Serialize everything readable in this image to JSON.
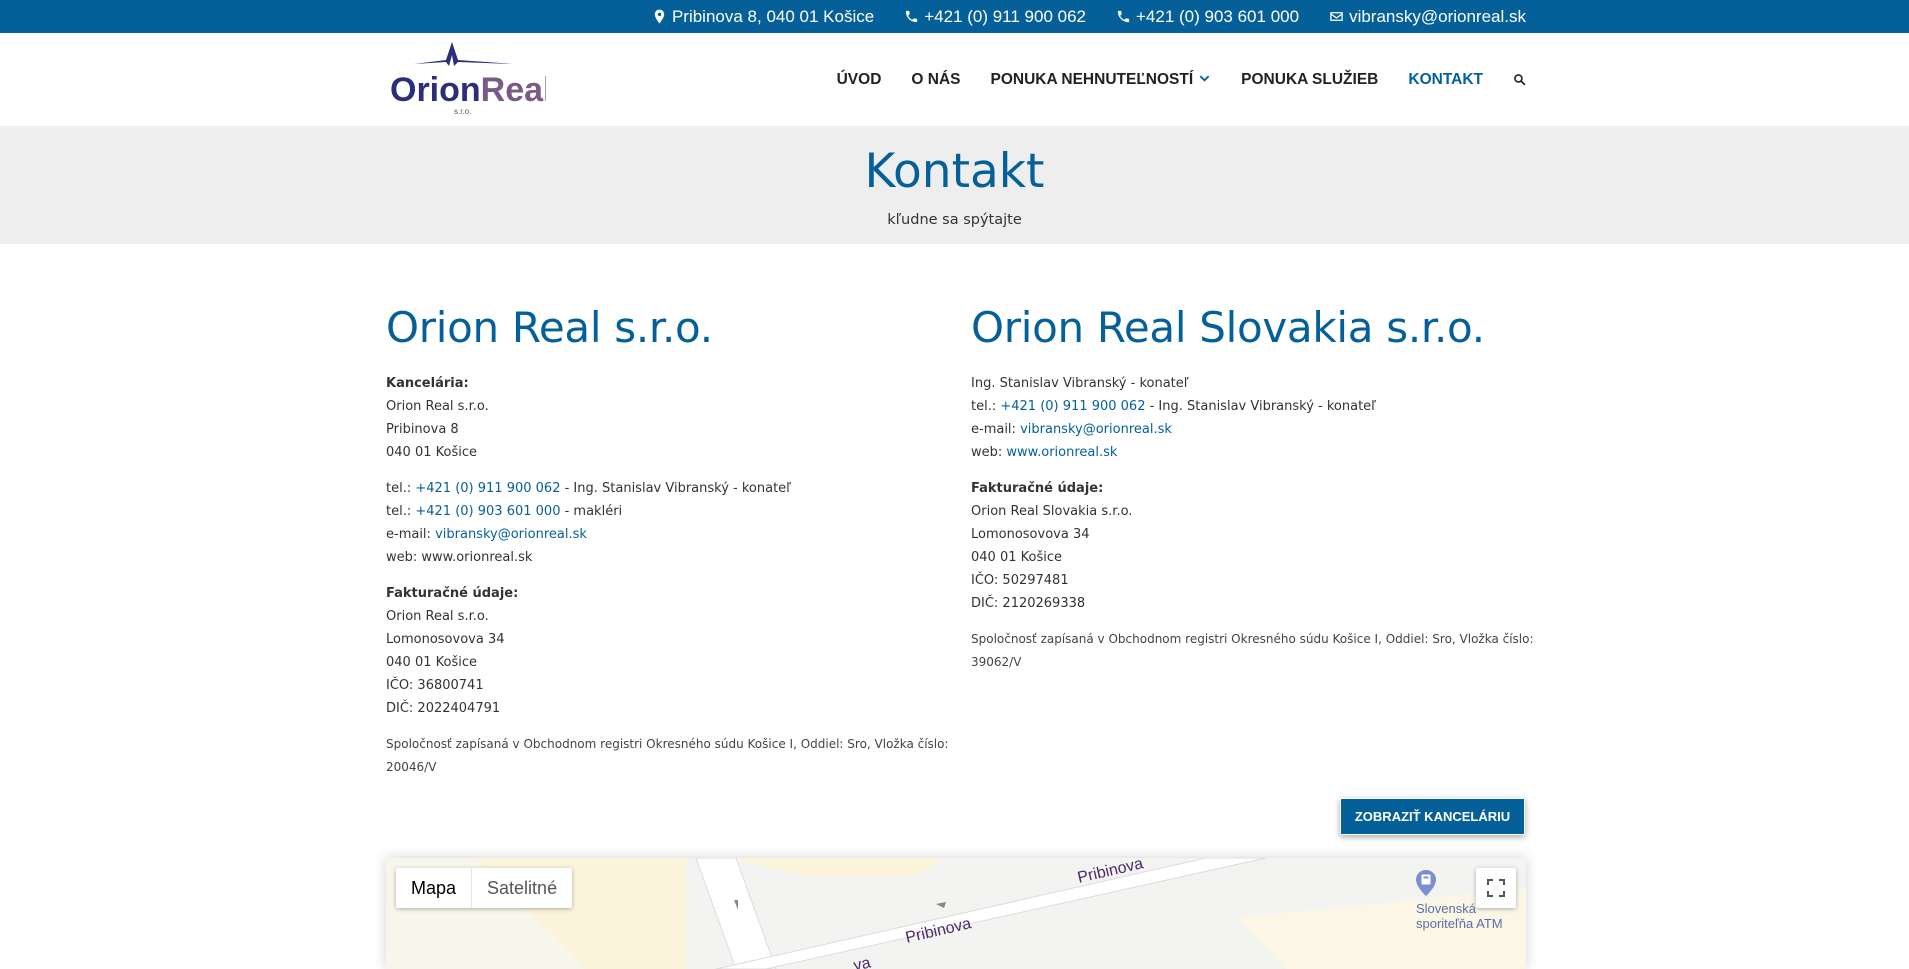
{
  "topbar": {
    "address": "Pribinova 8, 040 01 Košice",
    "phone1": "+421 (0) 911 900 062",
    "phone2": "+421 (0) 903 601 000",
    "email": "vibransky@orionreal.sk"
  },
  "logo": {
    "text_left": "Orion",
    "text_right": "Real",
    "sub": "s.r.o."
  },
  "nav": [
    {
      "label": "ÚVOD"
    },
    {
      "label": "O NÁS"
    },
    {
      "label": "PONUKA NEHNUTEĽNOSTÍ"
    },
    {
      "label": "PONUKA SLUŽIEB"
    },
    {
      "label": "KONTAKT"
    }
  ],
  "colors": {
    "brand": "#05609a",
    "band": "#eeeeee"
  },
  "page": {
    "title": "Kontakt",
    "subtitle": "kľudne sa spýtajte"
  },
  "left": {
    "company": "Orion Real s.r.o.",
    "office_heading": "Kancelária:",
    "office_lines": [
      "Orion Real s.r.o.",
      "Pribinova 8",
      "040 01 Košice"
    ],
    "tel_prefix": "tel.:",
    "tel1_number": "+421 (0) 911 900 062",
    "tel1_suffix": " - Ing. Stanislav Vibranský - konateľ",
    "tel2_number": "+421 (0) 903 601 000",
    "tel2_suffix": " - makléri",
    "email_prefix": "e-mail:",
    "email": "vibransky@orionreal.sk",
    "web_line": "web: www.orionreal.sk",
    "billing_heading": "Fakturačné údaje:",
    "billing_lines": [
      "Orion Real s.r.o.",
      "Lomonosovova 34",
      "040 01 Košice",
      "IČO: 36800741",
      "DIČ: 2022404791"
    ],
    "note_line1": "Spoločnosť zapísaná v Obchodnom registri Okresného súdu Košice I, Oddiel: Sro, Vložka číslo:",
    "note_line2": "20046/V"
  },
  "right": {
    "company": "Orion Real Slovakia s.r.o.",
    "person": "Ing. Stanislav Vibranský - konateľ",
    "tel_prefix": "tel.:",
    "tel_number": "+421 (0) 911 900 062",
    "tel_suffix": " - Ing. Stanislav Vibranský - konateľ",
    "email_prefix": "e-mail:",
    "email": "vibransky@orionreal.sk",
    "web_prefix": "web:",
    "web": "www.orionreal.sk",
    "billing_heading": "Fakturačné údaje:",
    "billing_lines": [
      "Orion Real Slovakia s.r.o.",
      "Lomonosovova 34",
      "040 01 Košice",
      "IČO: 50297481",
      "DIČ: 2120269338"
    ],
    "note_line1": "Spoločnosť zapísaná v Obchodnom registri Okresného súdu Košice I, Oddiel: Sro, Vložka číslo:",
    "note_line2": "39062/V"
  },
  "office_button": "ZOBRAZIŤ KANCELÁRIU",
  "map": {
    "type_map": "Mapa",
    "type_satellite": "Satelitné",
    "street1": "Pribinova",
    "street2": "Pribinova",
    "street3": "va",
    "poi_line1": "Slovenská",
    "poi_line2": "sporiteľňa ATM"
  }
}
